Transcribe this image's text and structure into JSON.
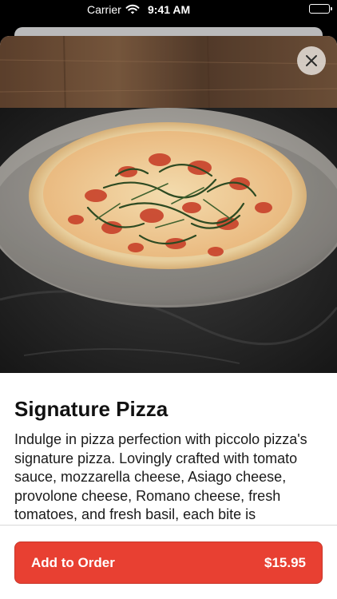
{
  "status_bar": {
    "carrier": "Carrier",
    "time": "9:41 AM"
  },
  "item": {
    "image_icon": "pizza-photo",
    "title": "Signature Pizza",
    "description": "Indulge in pizza perfection with piccolo pizza's signature pizza. Lovingly crafted with tomato sauce, mozzarella cheese, Asiago cheese, provolone cheese, Romano cheese, fresh tomatoes, and fresh basil, each bite is"
  },
  "actions": {
    "add_label": "Add to Order",
    "price": "$15.95"
  },
  "icons": {
    "close": "close-icon",
    "wifi": "wifi-icon",
    "battery": "battery-icon"
  },
  "colors": {
    "accent": "#e84032",
    "title": "#111111"
  }
}
